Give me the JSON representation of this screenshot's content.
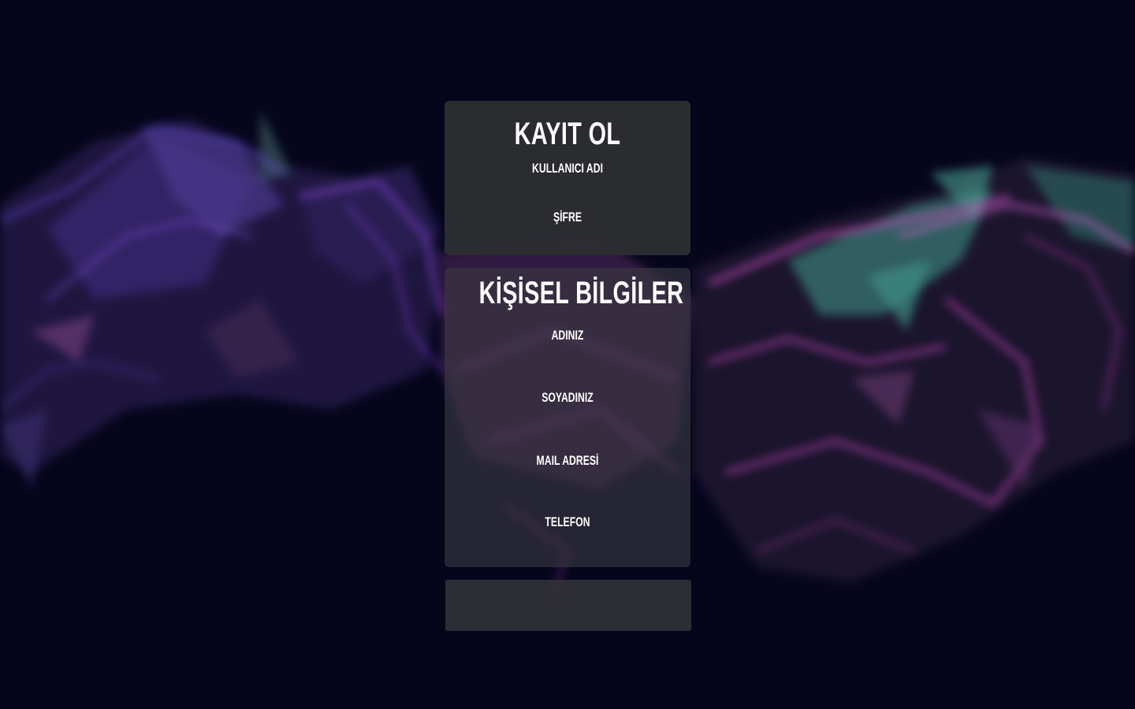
{
  "register": {
    "title": "KAYIT OL",
    "fields": [
      {
        "label": "KULLANICI ADI"
      },
      {
        "label": "ŞİFRE"
      }
    ]
  },
  "personal": {
    "title": "KİŞİSEL BİLGİLER",
    "fields": [
      {
        "label": "ADINIZ"
      },
      {
        "label": "SOYADINIZ"
      },
      {
        "label": "MAIL ADRESİ"
      },
      {
        "label": "TELEFON"
      }
    ]
  },
  "colors": {
    "background": "#04041a",
    "panel": "#2c2d32",
    "text": "#ffffff",
    "accent_purple": "#6a3fb8",
    "accent_magenta": "#c040b0",
    "accent_teal": "#3f8f84"
  }
}
